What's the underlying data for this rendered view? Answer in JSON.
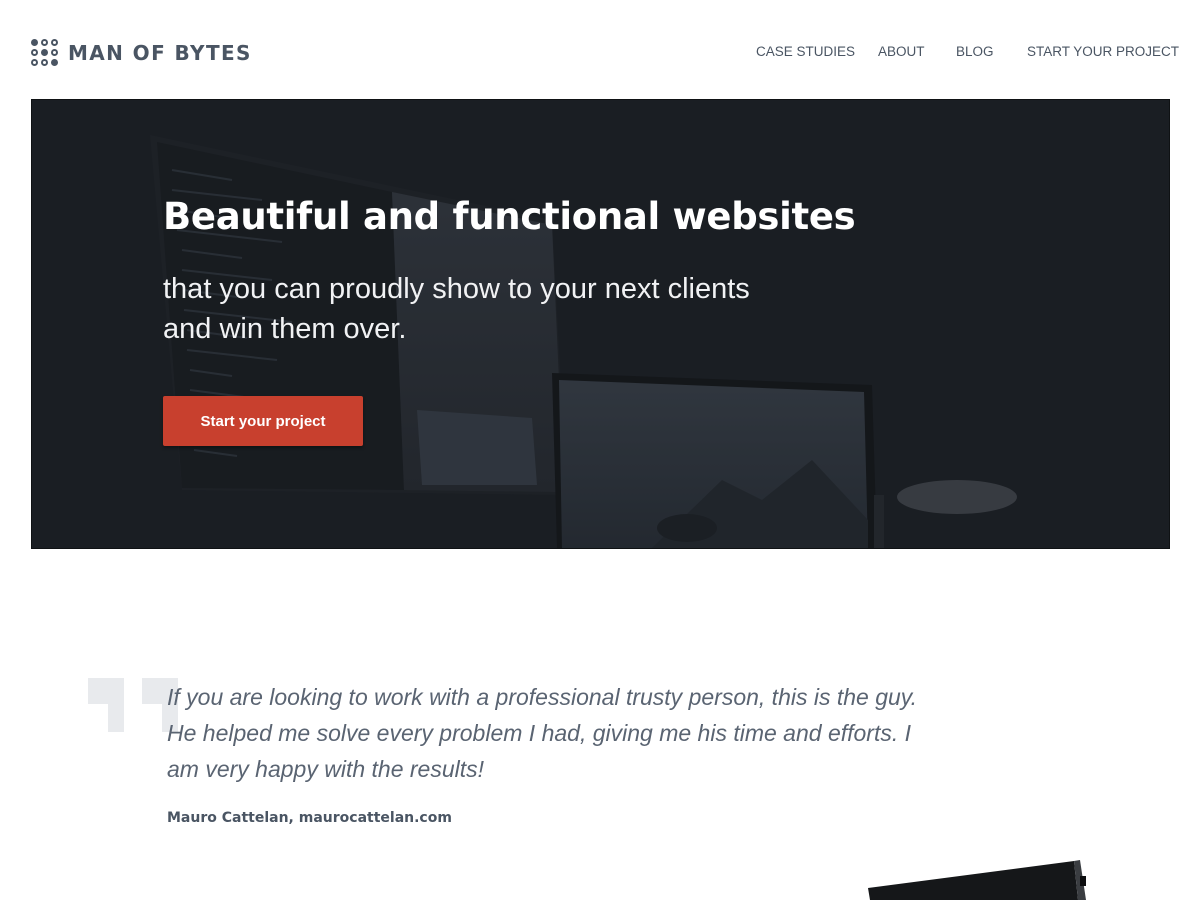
{
  "brand": {
    "name": "MAN OF BYTES",
    "icon": "nine-dot-grid-logo"
  },
  "nav": {
    "items": [
      {
        "label": "CASE STUDIES"
      },
      {
        "label": "ABOUT"
      },
      {
        "label": "BLOG"
      },
      {
        "label": "START YOUR PROJECT"
      }
    ]
  },
  "hero": {
    "title": "Beautiful and functional websites",
    "subtitle": "that you can proudly show to your next clients and win them over.",
    "cta_label": "Start your project",
    "background_image": "dark-desk-with-monitors-photo"
  },
  "testimonial": {
    "quote": "If you are looking to work with a professional trusty person, this is the guy. He helped me solve every problem I had, giving me his time and efforts. I am very happy with the results!",
    "author": "Mauro Cattelan, maurocattelan.com"
  },
  "colors": {
    "text": "#4a5563",
    "hero_bg": "#1d2126",
    "cta": "#c8402e",
    "quote_mark": "#e8eaed"
  }
}
